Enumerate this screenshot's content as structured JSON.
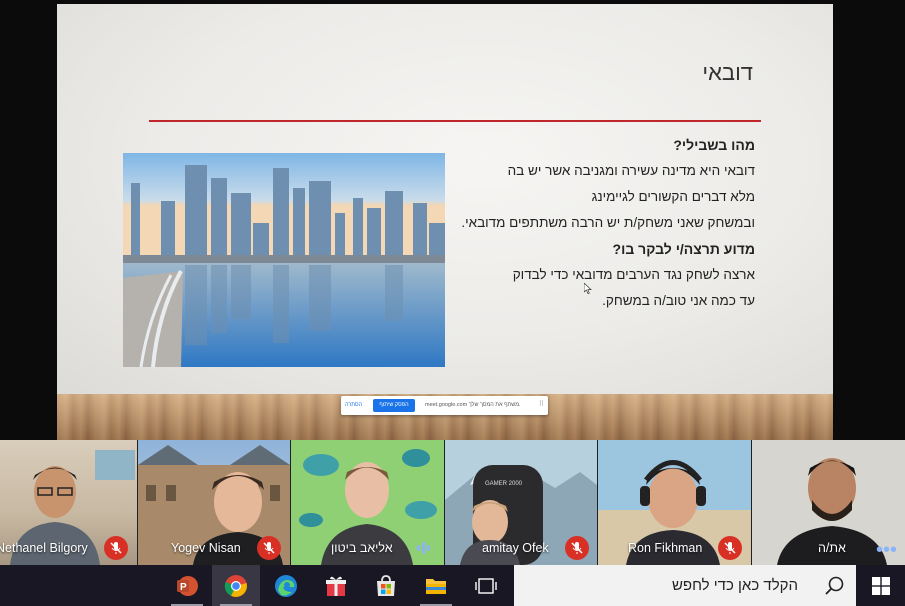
{
  "slide": {
    "title": "דובאי",
    "heading1": "מהו בשבילי?",
    "line1": "דובאי היא מדינה עשירה ומגניבה אשר יש בה",
    "line2": "מלא דברים הקשורים לגיימינג",
    "line3": "ובמשחק שאני משחק/ת יש הרבה משתתפים מדובאי.",
    "heading2": "מדוע תרצה/י  לבקר בו?",
    "line4": "ארצה לשחק נגד הערבים מדובאי כדי לבדוק",
    "line5": "עד כמה אני טוב/ה במשחק.",
    "accent_color": "#c0272d"
  },
  "share_bar": {
    "message": "meet.google.com משתף את המסך שלך.",
    "stop_label": "הפסק שיתוף",
    "hide_label": "הסתרה"
  },
  "participants": [
    {
      "name": "Nethanel Bilgory",
      "mic": "muted"
    },
    {
      "name": "Yogev Nisan",
      "mic": "muted"
    },
    {
      "name": "אליאב ביטון",
      "mic": "speaking"
    },
    {
      "name": "amitay Ofek",
      "mic": "muted"
    },
    {
      "name": "Ron Fikhman",
      "mic": "muted"
    },
    {
      "name": "את/ה",
      "mic": "more-options"
    }
  ],
  "taskbar": {
    "icons": [
      "powerpoint-icon",
      "chrome-icon",
      "edge-icon",
      "gift-icon",
      "store-icon",
      "file-explorer-icon",
      "task-view-icon"
    ],
    "search_placeholder": "הקלד כאן כדי לחפש",
    "search_icon": "magnifier-icon",
    "start_icon": "windows-icon"
  }
}
